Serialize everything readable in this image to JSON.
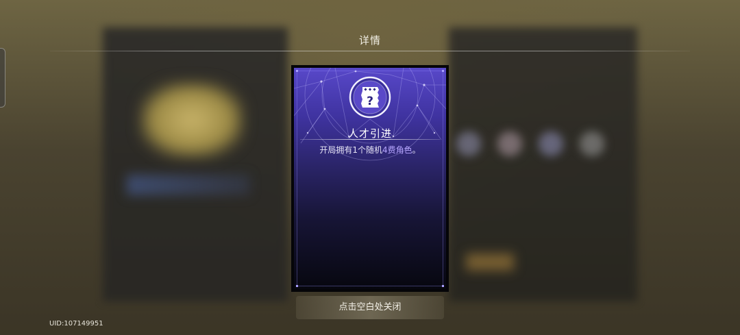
{
  "header": {
    "title": "详情"
  },
  "card": {
    "title": "人才引进",
    "description_before": "开局拥有1个随机",
    "description_highlight": "4费角色",
    "description_after": "。",
    "accent_color": "#5848c9",
    "highlight_color": "#b7a6ff",
    "icon": "mystery-scroll-icon"
  },
  "footer": {
    "close_hint": "点击空白处关闭",
    "uid": "UID:107149951"
  }
}
